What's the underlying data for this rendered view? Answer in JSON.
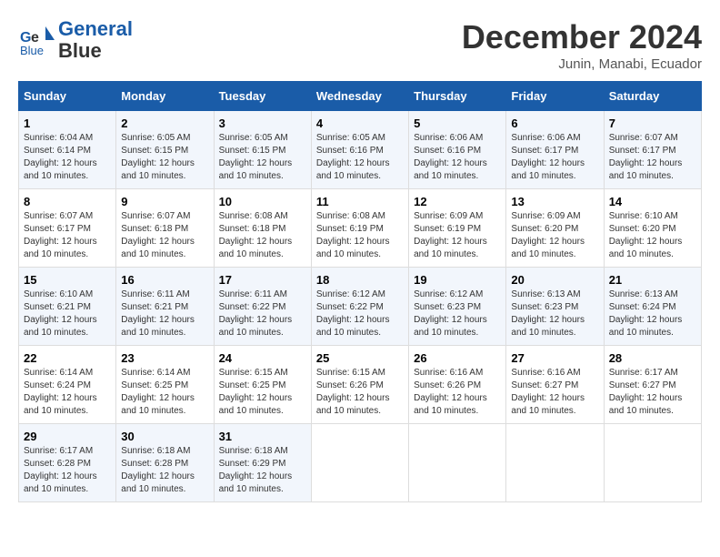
{
  "header": {
    "logo_line1": "General",
    "logo_line2": "Blue",
    "month": "December 2024",
    "location": "Junin, Manabi, Ecuador"
  },
  "days_of_week": [
    "Sunday",
    "Monday",
    "Tuesday",
    "Wednesday",
    "Thursday",
    "Friday",
    "Saturday"
  ],
  "weeks": [
    [
      {
        "day": "1",
        "sunrise": "6:04 AM",
        "sunset": "6:14 PM",
        "daylight": "12 hours and 10 minutes."
      },
      {
        "day": "2",
        "sunrise": "6:05 AM",
        "sunset": "6:15 PM",
        "daylight": "12 hours and 10 minutes."
      },
      {
        "day": "3",
        "sunrise": "6:05 AM",
        "sunset": "6:15 PM",
        "daylight": "12 hours and 10 minutes."
      },
      {
        "day": "4",
        "sunrise": "6:05 AM",
        "sunset": "6:16 PM",
        "daylight": "12 hours and 10 minutes."
      },
      {
        "day": "5",
        "sunrise": "6:06 AM",
        "sunset": "6:16 PM",
        "daylight": "12 hours and 10 minutes."
      },
      {
        "day": "6",
        "sunrise": "6:06 AM",
        "sunset": "6:17 PM",
        "daylight": "12 hours and 10 minutes."
      },
      {
        "day": "7",
        "sunrise": "6:07 AM",
        "sunset": "6:17 PM",
        "daylight": "12 hours and 10 minutes."
      }
    ],
    [
      {
        "day": "8",
        "sunrise": "6:07 AM",
        "sunset": "6:17 PM",
        "daylight": "12 hours and 10 minutes."
      },
      {
        "day": "9",
        "sunrise": "6:07 AM",
        "sunset": "6:18 PM",
        "daylight": "12 hours and 10 minutes."
      },
      {
        "day": "10",
        "sunrise": "6:08 AM",
        "sunset": "6:18 PM",
        "daylight": "12 hours and 10 minutes."
      },
      {
        "day": "11",
        "sunrise": "6:08 AM",
        "sunset": "6:19 PM",
        "daylight": "12 hours and 10 minutes."
      },
      {
        "day": "12",
        "sunrise": "6:09 AM",
        "sunset": "6:19 PM",
        "daylight": "12 hours and 10 minutes."
      },
      {
        "day": "13",
        "sunrise": "6:09 AM",
        "sunset": "6:20 PM",
        "daylight": "12 hours and 10 minutes."
      },
      {
        "day": "14",
        "sunrise": "6:10 AM",
        "sunset": "6:20 PM",
        "daylight": "12 hours and 10 minutes."
      }
    ],
    [
      {
        "day": "15",
        "sunrise": "6:10 AM",
        "sunset": "6:21 PM",
        "daylight": "12 hours and 10 minutes."
      },
      {
        "day": "16",
        "sunrise": "6:11 AM",
        "sunset": "6:21 PM",
        "daylight": "12 hours and 10 minutes."
      },
      {
        "day": "17",
        "sunrise": "6:11 AM",
        "sunset": "6:22 PM",
        "daylight": "12 hours and 10 minutes."
      },
      {
        "day": "18",
        "sunrise": "6:12 AM",
        "sunset": "6:22 PM",
        "daylight": "12 hours and 10 minutes."
      },
      {
        "day": "19",
        "sunrise": "6:12 AM",
        "sunset": "6:23 PM",
        "daylight": "12 hours and 10 minutes."
      },
      {
        "day": "20",
        "sunrise": "6:13 AM",
        "sunset": "6:23 PM",
        "daylight": "12 hours and 10 minutes."
      },
      {
        "day": "21",
        "sunrise": "6:13 AM",
        "sunset": "6:24 PM",
        "daylight": "12 hours and 10 minutes."
      }
    ],
    [
      {
        "day": "22",
        "sunrise": "6:14 AM",
        "sunset": "6:24 PM",
        "daylight": "12 hours and 10 minutes."
      },
      {
        "day": "23",
        "sunrise": "6:14 AM",
        "sunset": "6:25 PM",
        "daylight": "12 hours and 10 minutes."
      },
      {
        "day": "24",
        "sunrise": "6:15 AM",
        "sunset": "6:25 PM",
        "daylight": "12 hours and 10 minutes."
      },
      {
        "day": "25",
        "sunrise": "6:15 AM",
        "sunset": "6:26 PM",
        "daylight": "12 hours and 10 minutes."
      },
      {
        "day": "26",
        "sunrise": "6:16 AM",
        "sunset": "6:26 PM",
        "daylight": "12 hours and 10 minutes."
      },
      {
        "day": "27",
        "sunrise": "6:16 AM",
        "sunset": "6:27 PM",
        "daylight": "12 hours and 10 minutes."
      },
      {
        "day": "28",
        "sunrise": "6:17 AM",
        "sunset": "6:27 PM",
        "daylight": "12 hours and 10 minutes."
      }
    ],
    [
      {
        "day": "29",
        "sunrise": "6:17 AM",
        "sunset": "6:28 PM",
        "daylight": "12 hours and 10 minutes."
      },
      {
        "day": "30",
        "sunrise": "6:18 AM",
        "sunset": "6:28 PM",
        "daylight": "12 hours and 10 minutes."
      },
      {
        "day": "31",
        "sunrise": "6:18 AM",
        "sunset": "6:29 PM",
        "daylight": "12 hours and 10 minutes."
      },
      null,
      null,
      null,
      null
    ]
  ]
}
